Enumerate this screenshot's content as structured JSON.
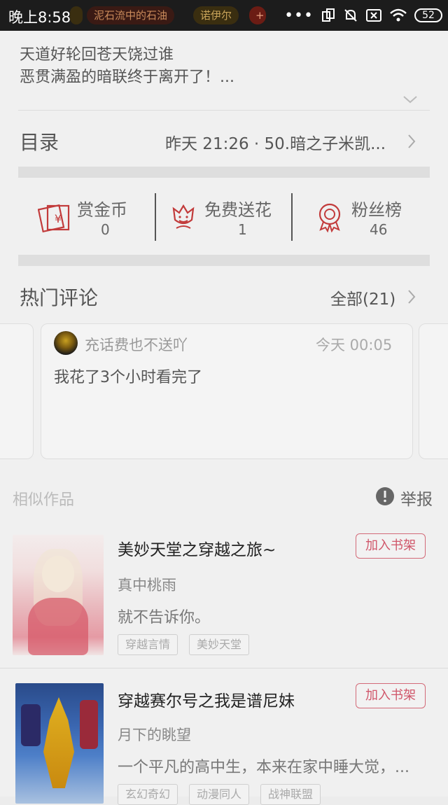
{
  "status_bar": {
    "time": "晚上8:58",
    "chips": [
      "泥石流中的石油",
      "诺伊尔",
      "+"
    ],
    "battery": "52"
  },
  "intro": {
    "line1": "天道好轮回苍天饶过谁",
    "line2": "恶贯满盈的暗联终于离开了！..."
  },
  "catalog": {
    "label": "目录",
    "latest": "昨天 21:26 · 50.暗之子米凯..."
  },
  "stats": [
    {
      "label": "赏金币",
      "value": "0"
    },
    {
      "label": "免费送花",
      "value": "1"
    },
    {
      "label": "粉丝榜",
      "value": "46"
    }
  ],
  "hot_comments": {
    "title": "热门评论",
    "all_link": "全部(21)",
    "comment": {
      "user": "充话费也不送吖",
      "time": "今天 00:05",
      "text": "我花了3个小时看完了"
    }
  },
  "similar": {
    "title": "相似作品",
    "report": "举报",
    "books": [
      {
        "title": "美妙天堂之穿越之旅~",
        "author": "真中桃雨",
        "desc": "就不告诉你。",
        "tags": [
          "穿越言情",
          "美妙天堂"
        ],
        "button": "加入书架"
      },
      {
        "title": "穿越赛尔号之我是谱尼妹",
        "author": "月下的眺望",
        "desc": "一个平凡的高中生，本来在家中睡大觉，...",
        "tags": [
          "玄幻奇幻",
          "动漫同人",
          "战神联盟"
        ],
        "button": "加入书架"
      }
    ]
  },
  "colors": {
    "accent_red": "#c23b3b",
    "button_pink": "#d0566a",
    "status_bar": "#1c1c1c"
  }
}
